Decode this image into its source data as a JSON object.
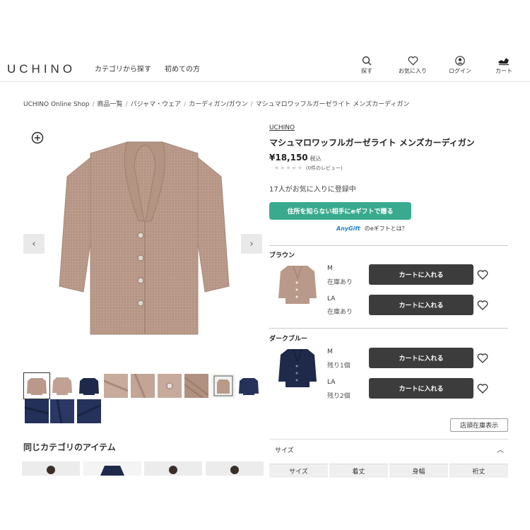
{
  "header": {
    "logo": "UCHINO",
    "nav": [
      "カテゴリから探す",
      "初めての方"
    ],
    "icons": [
      {
        "label": "探す",
        "icon": "search-icon"
      },
      {
        "label": "お気に入り",
        "icon": "heart-icon"
      },
      {
        "label": "ログイン",
        "icon": "user-icon"
      },
      {
        "label": "カート",
        "icon": "cart-icon"
      }
    ]
  },
  "breadcrumb": [
    "UCHINO Online Shop",
    "商品一覧",
    "パジャマ・ウェア",
    "カーディガン/ガウン",
    "マシュマロワッフルガーゼライト メンズカーディガン"
  ],
  "product": {
    "brand": "UCHINO",
    "title": "マシュマロワッフルガーゼライト メンズカーディガン",
    "price": "¥18,150",
    "tax": "税込",
    "rating_stars": "★★★★★",
    "rating_score": 0,
    "review_count": "(0件のレビュー)",
    "favorite_count": "17人がお気に入りに登録中",
    "gift_button": "住所を知らない相手にeギフトで贈る",
    "anygift_logo": "AnyGift",
    "anygift_link": "のeギフトとは？"
  },
  "variants": [
    {
      "color": "ブラウン",
      "sizes": [
        {
          "size": "M",
          "stock": "在庫あり",
          "cart": "カートに入れる"
        },
        {
          "size": "LA",
          "stock": "在庫あり",
          "cart": "カートに入れる"
        }
      ]
    },
    {
      "color": "ダークブルー",
      "sizes": [
        {
          "size": "M",
          "stock": "残り1個",
          "cart": "カートに入れる"
        },
        {
          "size": "LA",
          "stock": "残り2個",
          "cart": "カートに入れる"
        }
      ]
    }
  ],
  "store_stock_button": "店頭在庫表示",
  "size_section": {
    "label": "サイズ",
    "columns": [
      "サイズ",
      "着丈",
      "身幅",
      "裄丈"
    ]
  },
  "related": {
    "title": "同じカテゴリのアイテム"
  },
  "colors": {
    "brown": "#b9998a",
    "navy": "#1f2a4a",
    "gift_green": "#3aaa8e",
    "cart_dark": "#3c3c3c"
  }
}
